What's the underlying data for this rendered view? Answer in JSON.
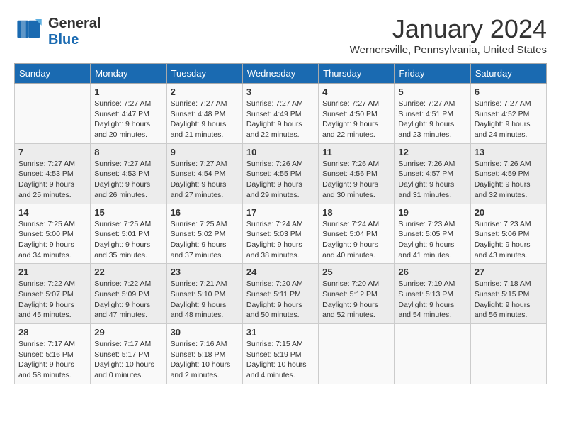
{
  "header": {
    "logo_general": "General",
    "logo_blue": "Blue",
    "month": "January 2024",
    "location": "Wernersville, Pennsylvania, United States"
  },
  "days_of_week": [
    "Sunday",
    "Monday",
    "Tuesday",
    "Wednesday",
    "Thursday",
    "Friday",
    "Saturday"
  ],
  "weeks": [
    [
      {
        "num": "",
        "sunrise": "",
        "sunset": "",
        "daylight": ""
      },
      {
        "num": "1",
        "sunrise": "Sunrise: 7:27 AM",
        "sunset": "Sunset: 4:47 PM",
        "daylight": "Daylight: 9 hours and 20 minutes."
      },
      {
        "num": "2",
        "sunrise": "Sunrise: 7:27 AM",
        "sunset": "Sunset: 4:48 PM",
        "daylight": "Daylight: 9 hours and 21 minutes."
      },
      {
        "num": "3",
        "sunrise": "Sunrise: 7:27 AM",
        "sunset": "Sunset: 4:49 PM",
        "daylight": "Daylight: 9 hours and 22 minutes."
      },
      {
        "num": "4",
        "sunrise": "Sunrise: 7:27 AM",
        "sunset": "Sunset: 4:50 PM",
        "daylight": "Daylight: 9 hours and 22 minutes."
      },
      {
        "num": "5",
        "sunrise": "Sunrise: 7:27 AM",
        "sunset": "Sunset: 4:51 PM",
        "daylight": "Daylight: 9 hours and 23 minutes."
      },
      {
        "num": "6",
        "sunrise": "Sunrise: 7:27 AM",
        "sunset": "Sunset: 4:52 PM",
        "daylight": "Daylight: 9 hours and 24 minutes."
      }
    ],
    [
      {
        "num": "7",
        "sunrise": "Sunrise: 7:27 AM",
        "sunset": "Sunset: 4:53 PM",
        "daylight": "Daylight: 9 hours and 25 minutes."
      },
      {
        "num": "8",
        "sunrise": "Sunrise: 7:27 AM",
        "sunset": "Sunset: 4:53 PM",
        "daylight": "Daylight: 9 hours and 26 minutes."
      },
      {
        "num": "9",
        "sunrise": "Sunrise: 7:27 AM",
        "sunset": "Sunset: 4:54 PM",
        "daylight": "Daylight: 9 hours and 27 minutes."
      },
      {
        "num": "10",
        "sunrise": "Sunrise: 7:26 AM",
        "sunset": "Sunset: 4:55 PM",
        "daylight": "Daylight: 9 hours and 29 minutes."
      },
      {
        "num": "11",
        "sunrise": "Sunrise: 7:26 AM",
        "sunset": "Sunset: 4:56 PM",
        "daylight": "Daylight: 9 hours and 30 minutes."
      },
      {
        "num": "12",
        "sunrise": "Sunrise: 7:26 AM",
        "sunset": "Sunset: 4:57 PM",
        "daylight": "Daylight: 9 hours and 31 minutes."
      },
      {
        "num": "13",
        "sunrise": "Sunrise: 7:26 AM",
        "sunset": "Sunset: 4:59 PM",
        "daylight": "Daylight: 9 hours and 32 minutes."
      }
    ],
    [
      {
        "num": "14",
        "sunrise": "Sunrise: 7:25 AM",
        "sunset": "Sunset: 5:00 PM",
        "daylight": "Daylight: 9 hours and 34 minutes."
      },
      {
        "num": "15",
        "sunrise": "Sunrise: 7:25 AM",
        "sunset": "Sunset: 5:01 PM",
        "daylight": "Daylight: 9 hours and 35 minutes."
      },
      {
        "num": "16",
        "sunrise": "Sunrise: 7:25 AM",
        "sunset": "Sunset: 5:02 PM",
        "daylight": "Daylight: 9 hours and 37 minutes."
      },
      {
        "num": "17",
        "sunrise": "Sunrise: 7:24 AM",
        "sunset": "Sunset: 5:03 PM",
        "daylight": "Daylight: 9 hours and 38 minutes."
      },
      {
        "num": "18",
        "sunrise": "Sunrise: 7:24 AM",
        "sunset": "Sunset: 5:04 PM",
        "daylight": "Daylight: 9 hours and 40 minutes."
      },
      {
        "num": "19",
        "sunrise": "Sunrise: 7:23 AM",
        "sunset": "Sunset: 5:05 PM",
        "daylight": "Daylight: 9 hours and 41 minutes."
      },
      {
        "num": "20",
        "sunrise": "Sunrise: 7:23 AM",
        "sunset": "Sunset: 5:06 PM",
        "daylight": "Daylight: 9 hours and 43 minutes."
      }
    ],
    [
      {
        "num": "21",
        "sunrise": "Sunrise: 7:22 AM",
        "sunset": "Sunset: 5:07 PM",
        "daylight": "Daylight: 9 hours and 45 minutes."
      },
      {
        "num": "22",
        "sunrise": "Sunrise: 7:22 AM",
        "sunset": "Sunset: 5:09 PM",
        "daylight": "Daylight: 9 hours and 47 minutes."
      },
      {
        "num": "23",
        "sunrise": "Sunrise: 7:21 AM",
        "sunset": "Sunset: 5:10 PM",
        "daylight": "Daylight: 9 hours and 48 minutes."
      },
      {
        "num": "24",
        "sunrise": "Sunrise: 7:20 AM",
        "sunset": "Sunset: 5:11 PM",
        "daylight": "Daylight: 9 hours and 50 minutes."
      },
      {
        "num": "25",
        "sunrise": "Sunrise: 7:20 AM",
        "sunset": "Sunset: 5:12 PM",
        "daylight": "Daylight: 9 hours and 52 minutes."
      },
      {
        "num": "26",
        "sunrise": "Sunrise: 7:19 AM",
        "sunset": "Sunset: 5:13 PM",
        "daylight": "Daylight: 9 hours and 54 minutes."
      },
      {
        "num": "27",
        "sunrise": "Sunrise: 7:18 AM",
        "sunset": "Sunset: 5:15 PM",
        "daylight": "Daylight: 9 hours and 56 minutes."
      }
    ],
    [
      {
        "num": "28",
        "sunrise": "Sunrise: 7:17 AM",
        "sunset": "Sunset: 5:16 PM",
        "daylight": "Daylight: 9 hours and 58 minutes."
      },
      {
        "num": "29",
        "sunrise": "Sunrise: 7:17 AM",
        "sunset": "Sunset: 5:17 PM",
        "daylight": "Daylight: 10 hours and 0 minutes."
      },
      {
        "num": "30",
        "sunrise": "Sunrise: 7:16 AM",
        "sunset": "Sunset: 5:18 PM",
        "daylight": "Daylight: 10 hours and 2 minutes."
      },
      {
        "num": "31",
        "sunrise": "Sunrise: 7:15 AM",
        "sunset": "Sunset: 5:19 PM",
        "daylight": "Daylight: 10 hours and 4 minutes."
      },
      {
        "num": "",
        "sunrise": "",
        "sunset": "",
        "daylight": ""
      },
      {
        "num": "",
        "sunrise": "",
        "sunset": "",
        "daylight": ""
      },
      {
        "num": "",
        "sunrise": "",
        "sunset": "",
        "daylight": ""
      }
    ]
  ]
}
